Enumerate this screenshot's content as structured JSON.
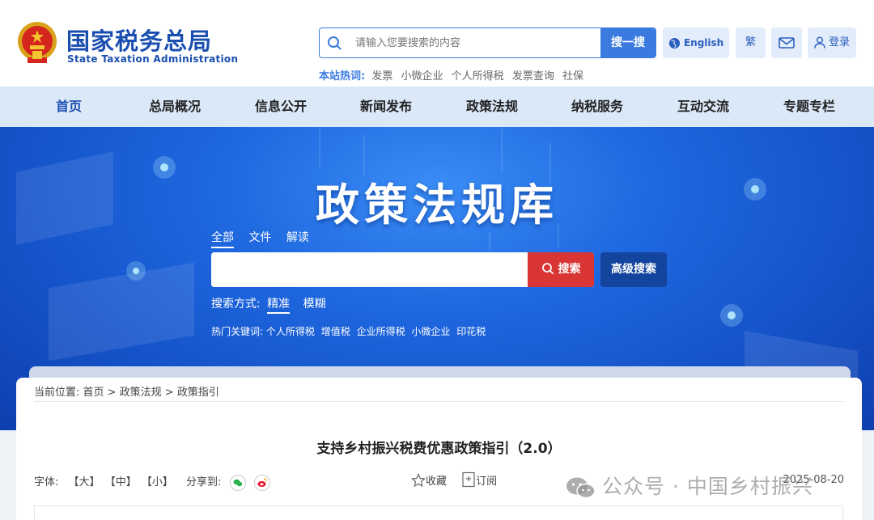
{
  "header": {
    "title": "国家税务总局",
    "subtitle": "State Taxation Administration",
    "search_placeholder": "请输入您要搜索的内容",
    "search_button": "搜一搜",
    "english": "English",
    "traditional": "繁",
    "login": "登录",
    "hot_label": "本站热词:",
    "hot_words": [
      "发票",
      "小微企业",
      "个人所得税",
      "发票查询",
      "社保"
    ]
  },
  "nav": [
    "首页",
    "总局概况",
    "信息公开",
    "新闻发布",
    "政策法规",
    "纳税服务",
    "互动交流",
    "专题专栏"
  ],
  "banner": {
    "title": "政策法规库",
    "tabs": [
      "全部",
      "文件",
      "解读"
    ],
    "search_button": "搜索",
    "advanced_button": "高级搜索",
    "mode_label": "搜索方式:",
    "modes": [
      "精准",
      "模糊"
    ],
    "keywords_label": "热门关键词:",
    "keywords": [
      "个人所得税",
      "增值税",
      "企业所得税",
      "小微企业",
      "印花税"
    ]
  },
  "article": {
    "breadcrumb": "当前位置: 首页 > 政策法规 > 政策指引",
    "title": "支持乡村振兴税费优惠政策指引（2.0）",
    "font_label": "字体:",
    "font_large": "【大】",
    "font_medium": "【中】",
    "font_small": "【小】",
    "share_label": "分享到:",
    "favorite": "收藏",
    "subscribe": "订阅",
    "date": "2025-08-20"
  },
  "watermark": "公众号 · 中国乡村振兴",
  "colors": {
    "brand_blue": "#1a4fb0",
    "accent_blue": "#3b7be0",
    "search_red": "#d93535",
    "nav_bg": "#dbe8f8"
  }
}
